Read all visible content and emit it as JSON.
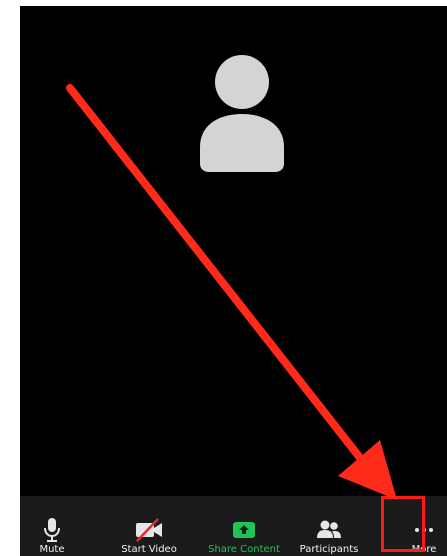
{
  "toolbar": {
    "buttons": [
      {
        "id": "mute",
        "label": "Mute",
        "icon": "microphone-icon"
      },
      {
        "id": "start_video",
        "label": "Start Video",
        "icon": "video-off-icon"
      },
      {
        "id": "share_content",
        "label": "Share Content",
        "icon": "share-screen-icon",
        "accent": "#22c35a"
      },
      {
        "id": "participants",
        "label": "Participants",
        "icon": "participants-icon"
      },
      {
        "id": "more",
        "label": "More",
        "icon": "more-dots-icon"
      }
    ]
  },
  "participant": {
    "avatar_icon": "user-avatar-icon",
    "avatar_color": "#d4d4d4"
  },
  "annotations": {
    "arrow_color": "#ff2a1a",
    "highlight_color": "#ff1a1a",
    "highlight_target": "more"
  },
  "colors": {
    "background": "#000000",
    "toolbar": "#1b1b1b",
    "label": "#f2f2f2",
    "share_accent": "#22c35a"
  }
}
